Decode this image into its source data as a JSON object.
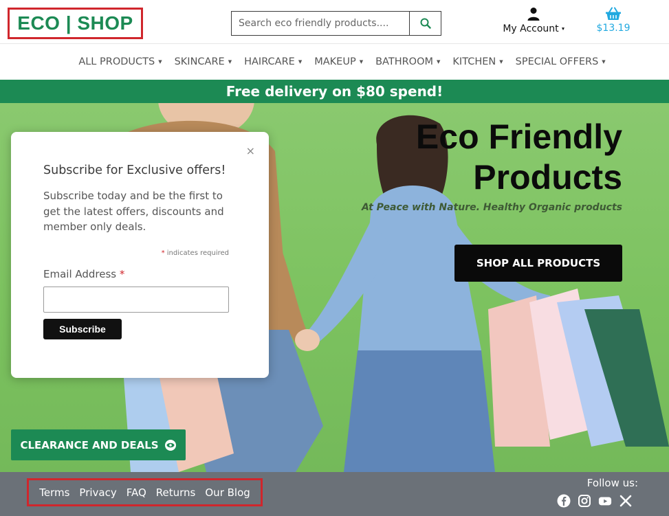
{
  "header": {
    "logo_text": "ECO | SHOP",
    "search_placeholder": "Search eco friendly products....",
    "account_label": "My Account",
    "cart_total": "$13.19"
  },
  "nav": {
    "items": [
      {
        "label": "ALL PRODUCTS"
      },
      {
        "label": "SKINCARE"
      },
      {
        "label": "HAIRCARE"
      },
      {
        "label": "MAKEUP"
      },
      {
        "label": "BATHROOM"
      },
      {
        "label": "KITCHEN"
      },
      {
        "label": "SPECIAL OFFERS"
      }
    ]
  },
  "promo": {
    "text": "Free delivery on $80 spend!"
  },
  "hero": {
    "title_line1": "Eco Friendly",
    "title_line2": "Products",
    "subtitle": "At Peace with Nature. Healthy Organic products",
    "cta_label": "SHOP ALL PRODUCTS",
    "deals_label": "CLEARANCE AND DEALS"
  },
  "popup": {
    "close_glyph": "×",
    "title": "Subscribe for Exclusive offers!",
    "body": "Subscribe today and be the first to get the latest offers, discounts and member only deals.",
    "required_star": "*",
    "required_note": " indicates required",
    "email_label": "Email Address ",
    "subscribe_label": "Subscribe"
  },
  "footer": {
    "links": [
      {
        "label": "Terms"
      },
      {
        "label": "Privacy"
      },
      {
        "label": "FAQ"
      },
      {
        "label": "Returns"
      },
      {
        "label": "Our Blog"
      }
    ],
    "follow_label": "Follow us:",
    "socials": [
      "facebook-icon",
      "instagram-icon",
      "youtube-icon",
      "x-icon"
    ]
  },
  "colors": {
    "brand_green": "#1c8a54",
    "highlight_red": "#d0262c",
    "cart_blue": "#21a9e0",
    "footer_grey": "#6b7178",
    "hero_green": "#7cc25f"
  }
}
